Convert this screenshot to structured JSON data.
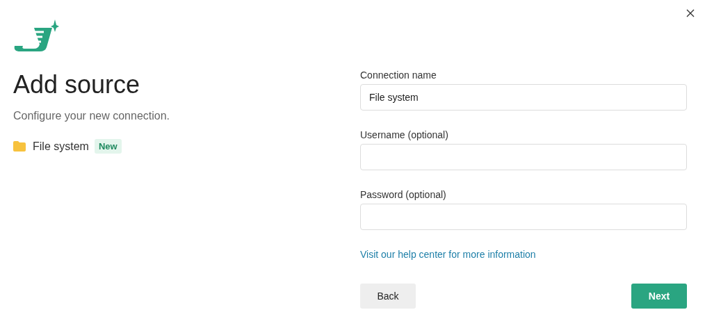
{
  "title": "Add source",
  "subtitle": "Configure your new connection.",
  "source": {
    "name": "File system",
    "badge": "New"
  },
  "fields": [
    {
      "label": "Connection name",
      "value": "File system"
    },
    {
      "label": "Username (optional)"
    },
    {
      "label": "Password (optional)"
    }
  ],
  "help_link": "Visit our help center for more information",
  "buttons": {
    "back": "Back",
    "next": "Next"
  }
}
